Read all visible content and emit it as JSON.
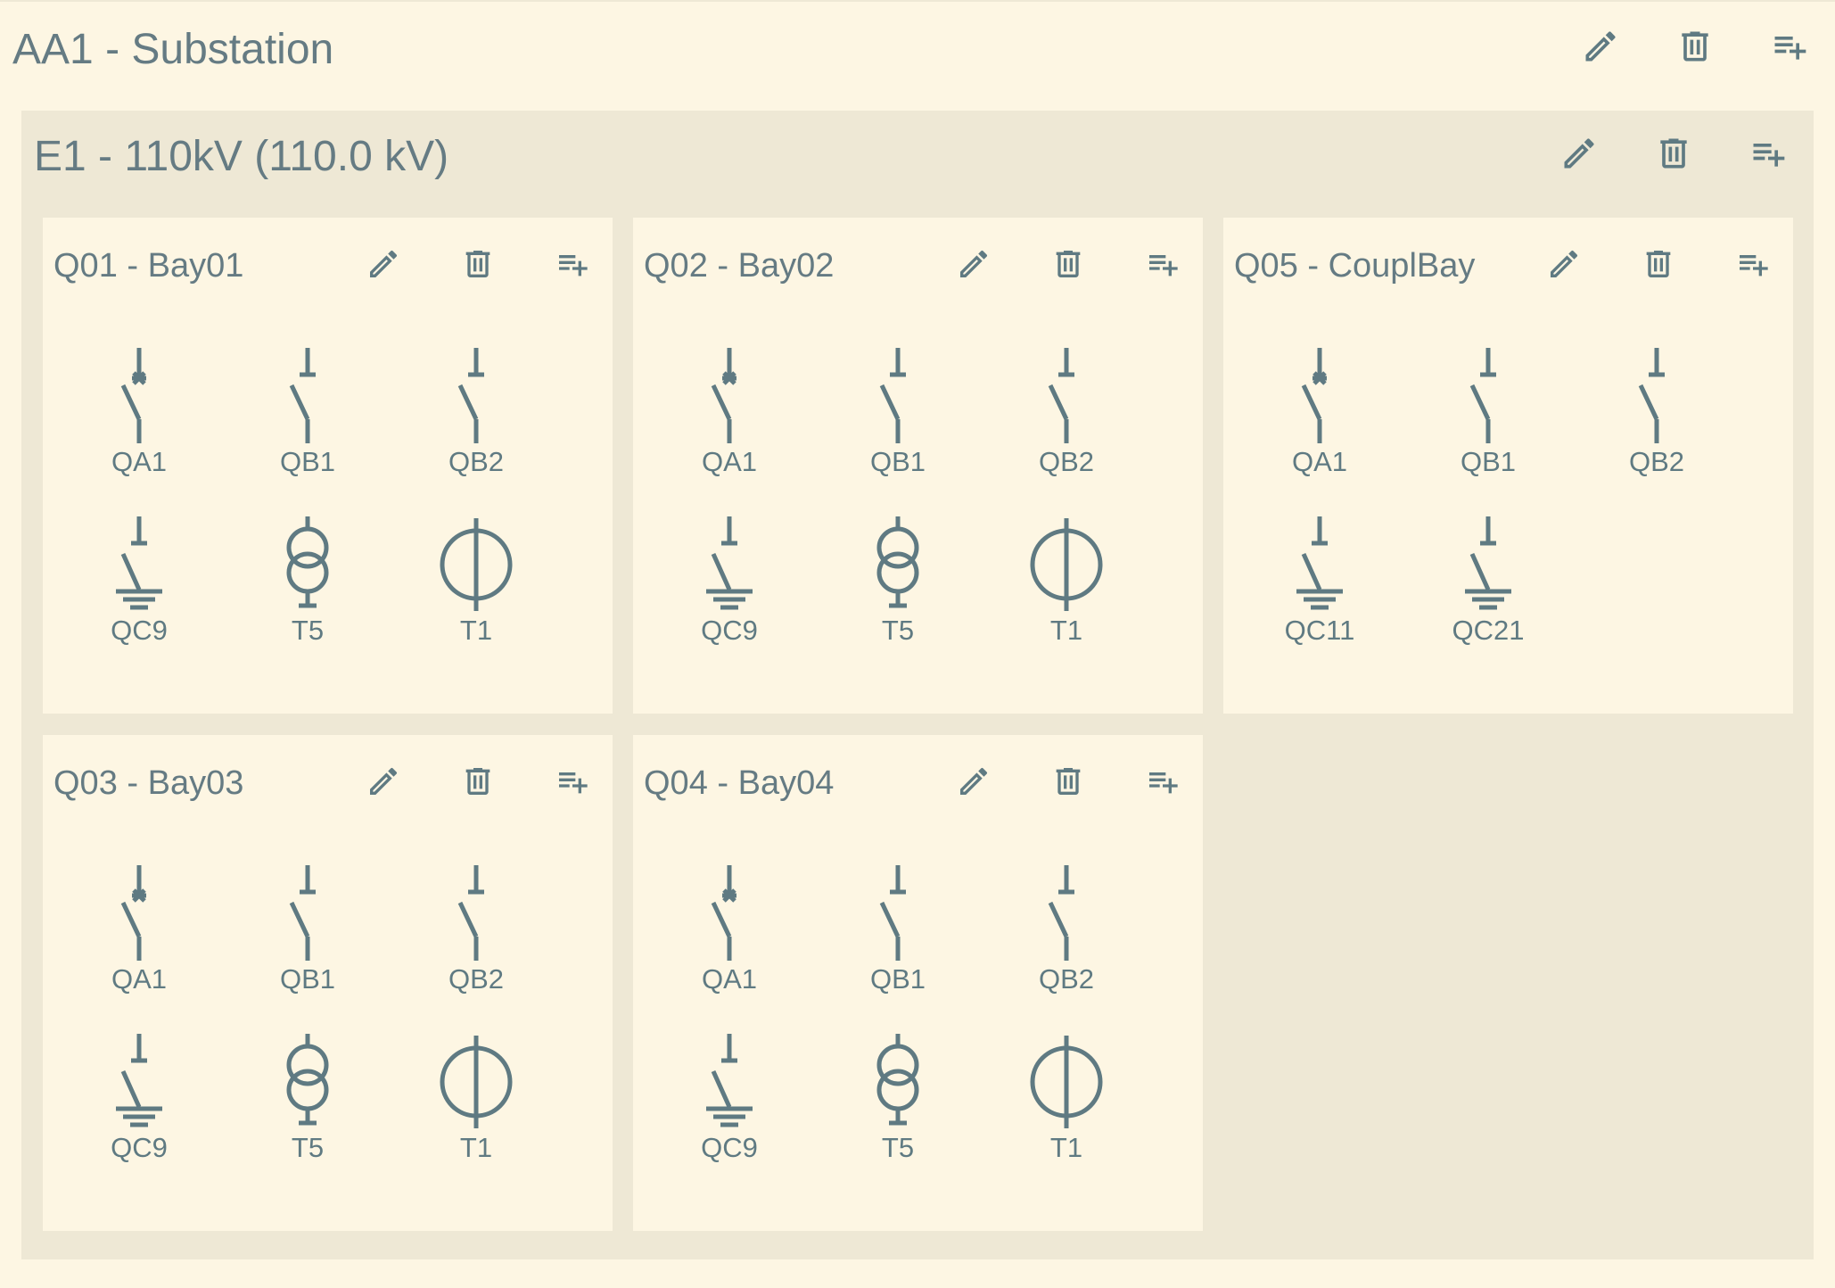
{
  "substation": {
    "title": "AA1 - Substation",
    "actions": [
      "edit-icon",
      "delete-icon",
      "add-icon"
    ]
  },
  "voltage_level": {
    "title": "E1 - 110kV (110.0 kV)"
  },
  "bays": [
    {
      "title": "Q01 - Bay01",
      "equipment": [
        {
          "label": "QA1",
          "type": "CBR"
        },
        {
          "label": "QB1",
          "type": "DIS"
        },
        {
          "label": "QB2",
          "type": "DIS"
        },
        {
          "label": "QC9",
          "type": "ERS"
        },
        {
          "label": "T5",
          "type": "VTR"
        },
        {
          "label": "T1",
          "type": "CTR"
        }
      ]
    },
    {
      "title": "Q02 - Bay02",
      "equipment": [
        {
          "label": "QA1",
          "type": "CBR"
        },
        {
          "label": "QB1",
          "type": "DIS"
        },
        {
          "label": "QB2",
          "type": "DIS"
        },
        {
          "label": "QC9",
          "type": "ERS"
        },
        {
          "label": "T5",
          "type": "VTR"
        },
        {
          "label": "T1",
          "type": "CTR"
        }
      ]
    },
    {
      "title": "Q05 - CouplBay",
      "equipment": [
        {
          "label": "QA1",
          "type": "CBR"
        },
        {
          "label": "QB1",
          "type": "DIS"
        },
        {
          "label": "QB2",
          "type": "DIS"
        },
        {
          "label": "QC11",
          "type": "ERS"
        },
        {
          "label": "QC21",
          "type": "ERS"
        }
      ]
    },
    {
      "title": "Q03 - Bay03",
      "equipment": [
        {
          "label": "QA1",
          "type": "CBR"
        },
        {
          "label": "QB1",
          "type": "DIS"
        },
        {
          "label": "QB2",
          "type": "DIS"
        },
        {
          "label": "QC9",
          "type": "ERS"
        },
        {
          "label": "T5",
          "type": "VTR"
        },
        {
          "label": "T1",
          "type": "CTR"
        }
      ]
    },
    {
      "title": "Q04 - Bay04",
      "equipment": [
        {
          "label": "QA1",
          "type": "CBR"
        },
        {
          "label": "QB1",
          "type": "DIS"
        },
        {
          "label": "QB2",
          "type": "DIS"
        },
        {
          "label": "QC9",
          "type": "ERS"
        },
        {
          "label": "T5",
          "type": "VTR"
        },
        {
          "label": "T1",
          "type": "CTR"
        }
      ]
    }
  ],
  "colors": {
    "background": "#fdf6e3",
    "voltage_level_bg": "#eee8d5",
    "icon": "#5f7a82",
    "text": "#657b83"
  }
}
